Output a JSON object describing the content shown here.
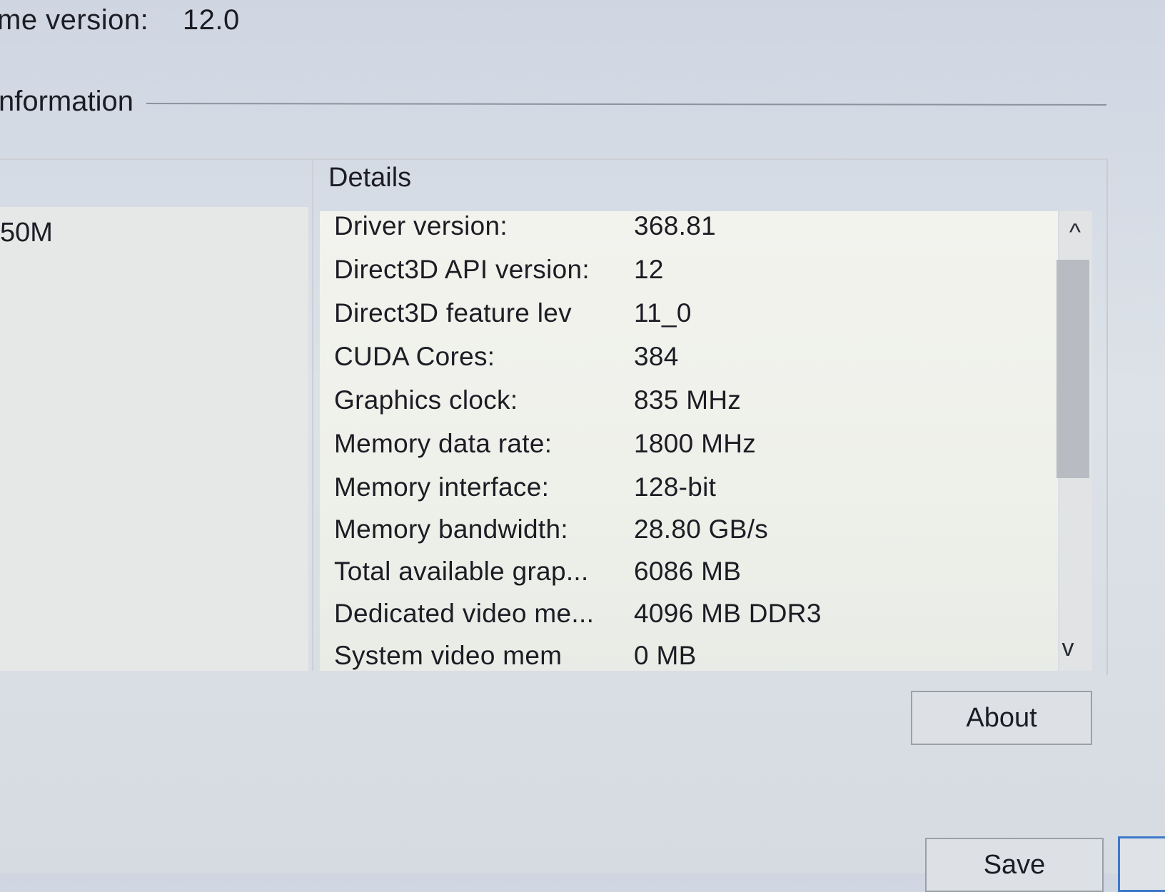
{
  "runtime": {
    "label": "me version:",
    "value": "12.0"
  },
  "section": {
    "title": "nformation"
  },
  "gpu_list": {
    "selected": "50M"
  },
  "details": {
    "header": "Details",
    "rows": [
      {
        "key": "Driver version:",
        "value": "368.81"
      },
      {
        "key": "Direct3D API version:",
        "value": "12"
      },
      {
        "key": "Direct3D feature lev",
        "value": "11_0"
      },
      {
        "key": "CUDA Cores:",
        "value": "384"
      },
      {
        "key": "Graphics clock:",
        "value": "835 MHz"
      },
      {
        "key": "Memory data rate:",
        "value": "1800 MHz"
      },
      {
        "key": "Memory interface:",
        "value": "128-bit"
      },
      {
        "key": "Memory bandwidth:",
        "value": "28.80 GB/s"
      },
      {
        "key": "Total available grap...",
        "value": "6086 MB"
      },
      {
        "key": "Dedicated video me...",
        "value": "4096 MB DDR3"
      },
      {
        "key": "System video mem",
        "value": "0 MB"
      }
    ]
  },
  "scrollbar": {
    "up_icon": "chevron-up-icon",
    "down_icon": "chevron-down-icon",
    "up_glyph": "^",
    "down_glyph": "v"
  },
  "buttons": {
    "about": "About",
    "save": "Save"
  }
}
